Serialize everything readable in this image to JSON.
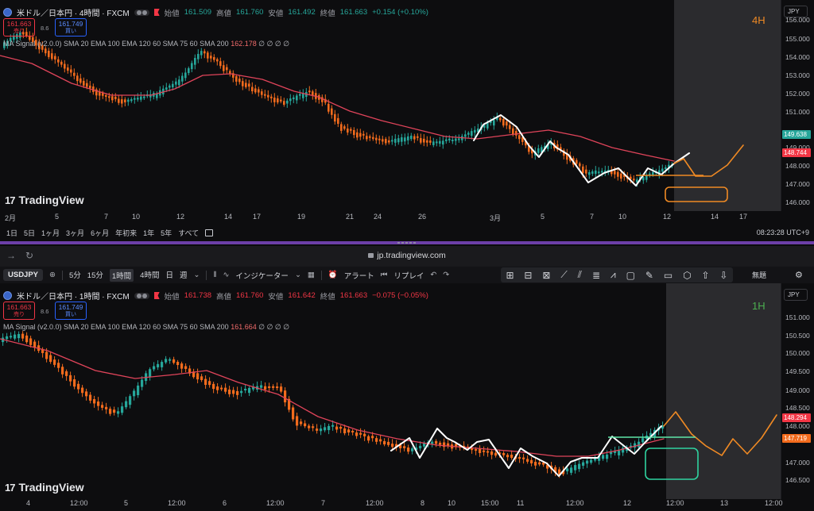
{
  "top_chart": {
    "symbol_title": "米ドル／日本円 · 4時間 · FXCM",
    "ohlc": {
      "open_label": "始値",
      "open": "161.509",
      "high_label": "高値",
      "high": "161.760",
      "low_label": "安値",
      "low": "161.492",
      "close_label": "終値",
      "close": "161.663",
      "change": "+0.154 (+0.10%)"
    },
    "sell_price": "161.663",
    "sell_label": "売り",
    "buy_price": "161.749",
    "buy_label": "買い",
    "spread": "8.6",
    "indicator": "MA Signal (v2.0.0) SMA 20 EMA 100 EMA 120 60 SMA 75 60 SMA 200",
    "indicator_value": "162.178",
    "indicator_icons": "∅ ∅ ∅ ∅",
    "timeframe_label": "4H",
    "currency": "JPY",
    "price_ticks": [
      "156.000",
      "155.000",
      "154.000",
      "153.000",
      "152.000",
      "151.000",
      "149.000",
      "148.000",
      "147.000",
      "146.000"
    ],
    "badge_green": "149.638",
    "badge_red": "148.744",
    "time_ticks": [
      "2月",
      "5",
      "7",
      "10",
      "12",
      "14",
      "17",
      "19",
      "21",
      "24",
      "26",
      "3月",
      "5",
      "7",
      "10",
      "12",
      "14",
      "17"
    ],
    "logo": "TradingView",
    "colors": {
      "up": "#26a69a",
      "down": "#f23645",
      "candle_up": "#26a69a",
      "candle_down": "#f26b1d",
      "ma": "#e0445a",
      "future": "#f08a24",
      "zone": "#2b2b2e"
    }
  },
  "range_bar": {
    "items": [
      "1日",
      "5日",
      "1ヶ月",
      "3ヶ月",
      "6ヶ月",
      "年初来",
      "1年",
      "5年",
      "すべて"
    ],
    "clock": "08:23:28 UTC+9"
  },
  "browser": {
    "url": "jp.tradingview.com"
  },
  "toolbar": {
    "symbol": "USDJPY",
    "intervals": [
      "5分",
      "15分",
      "1時間",
      "4時間",
      "日",
      "週"
    ],
    "active_interval": "1時間",
    "indicators_label": "インジケーター",
    "alert_label": "アラート",
    "replay_label": "リプレイ",
    "right_label": "無題"
  },
  "bottom_chart": {
    "symbol_title": "米ドル／日本円 · 1時間 · FXCM",
    "ohlc": {
      "open_label": "始値",
      "open": "161.738",
      "high_label": "高値",
      "high": "161.760",
      "low_label": "安値",
      "low": "161.642",
      "close_label": "終値",
      "close": "161.663",
      "change": "−0.075 (−0.05%)"
    },
    "sell_price": "161.663",
    "sell_label": "売り",
    "buy_price": "161.749",
    "buy_label": "買い",
    "spread": "8.6",
    "indicator": "MA Signal (v2.0.0) SMA 20 EMA 100 EMA 120 60 SMA 75 60 SMA 200",
    "indicator_value": "161.664",
    "indicator_icons": "∅ ∅ ∅ ∅",
    "timeframe_label": "1H",
    "currency": "JPY",
    "price_ticks": [
      "151.000",
      "150.500",
      "150.000",
      "149.500",
      "149.000",
      "148.500",
      "148.000",
      "147.000",
      "146.500"
    ],
    "badge_red": "148.294",
    "badge_orange": "147.719",
    "time_ticks": [
      "4",
      "12:00",
      "5",
      "12:00",
      "6",
      "12:00",
      "7",
      "12:00",
      "8",
      "10",
      "15:00",
      "11",
      "12:00",
      "12",
      "12:00",
      "13",
      "12:00"
    ],
    "logo": "TradingView",
    "colors": {
      "up": "#26a69a",
      "down": "#f23645",
      "ma": "#e0445a",
      "future": "#f08a24",
      "box": "#2fd3a0",
      "target": "#5ee6a8"
    }
  }
}
